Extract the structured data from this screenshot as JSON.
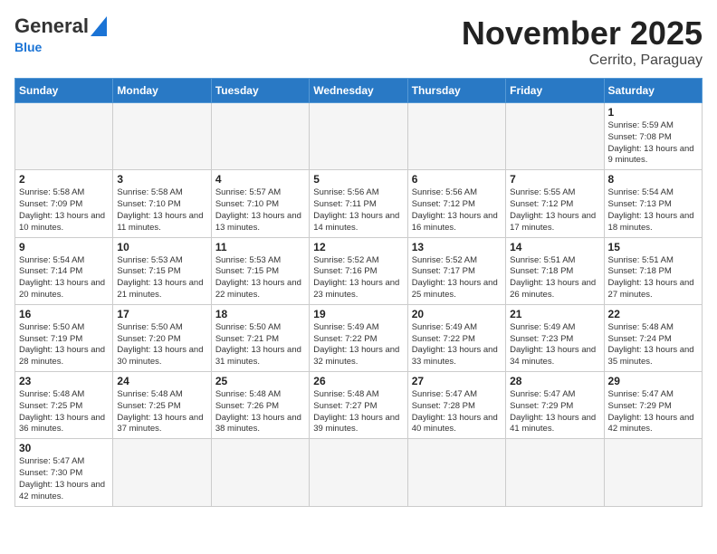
{
  "header": {
    "logo_general": "General",
    "logo_blue": "Blue",
    "month_title": "November 2025",
    "location": "Cerrito, Paraguay"
  },
  "weekdays": [
    "Sunday",
    "Monday",
    "Tuesday",
    "Wednesday",
    "Thursday",
    "Friday",
    "Saturday"
  ],
  "days": [
    {
      "num": "",
      "empty": true
    },
    {
      "num": "",
      "empty": true
    },
    {
      "num": "",
      "empty": true
    },
    {
      "num": "",
      "empty": true
    },
    {
      "num": "",
      "empty": true
    },
    {
      "num": "",
      "empty": true
    },
    {
      "num": "1",
      "sunrise": "5:59 AM",
      "sunset": "7:08 PM",
      "daylight": "13 hours and 9 minutes."
    },
    {
      "num": "2",
      "sunrise": "5:58 AM",
      "sunset": "7:09 PM",
      "daylight": "13 hours and 10 minutes."
    },
    {
      "num": "3",
      "sunrise": "5:58 AM",
      "sunset": "7:10 PM",
      "daylight": "13 hours and 11 minutes."
    },
    {
      "num": "4",
      "sunrise": "5:57 AM",
      "sunset": "7:10 PM",
      "daylight": "13 hours and 13 minutes."
    },
    {
      "num": "5",
      "sunrise": "5:56 AM",
      "sunset": "7:11 PM",
      "daylight": "13 hours and 14 minutes."
    },
    {
      "num": "6",
      "sunrise": "5:56 AM",
      "sunset": "7:12 PM",
      "daylight": "13 hours and 16 minutes."
    },
    {
      "num": "7",
      "sunrise": "5:55 AM",
      "sunset": "7:12 PM",
      "daylight": "13 hours and 17 minutes."
    },
    {
      "num": "8",
      "sunrise": "5:54 AM",
      "sunset": "7:13 PM",
      "daylight": "13 hours and 18 minutes."
    },
    {
      "num": "9",
      "sunrise": "5:54 AM",
      "sunset": "7:14 PM",
      "daylight": "13 hours and 20 minutes."
    },
    {
      "num": "10",
      "sunrise": "5:53 AM",
      "sunset": "7:15 PM",
      "daylight": "13 hours and 21 minutes."
    },
    {
      "num": "11",
      "sunrise": "5:53 AM",
      "sunset": "7:15 PM",
      "daylight": "13 hours and 22 minutes."
    },
    {
      "num": "12",
      "sunrise": "5:52 AM",
      "sunset": "7:16 PM",
      "daylight": "13 hours and 23 minutes."
    },
    {
      "num": "13",
      "sunrise": "5:52 AM",
      "sunset": "7:17 PM",
      "daylight": "13 hours and 25 minutes."
    },
    {
      "num": "14",
      "sunrise": "5:51 AM",
      "sunset": "7:18 PM",
      "daylight": "13 hours and 26 minutes."
    },
    {
      "num": "15",
      "sunrise": "5:51 AM",
      "sunset": "7:18 PM",
      "daylight": "13 hours and 27 minutes."
    },
    {
      "num": "16",
      "sunrise": "5:50 AM",
      "sunset": "7:19 PM",
      "daylight": "13 hours and 28 minutes."
    },
    {
      "num": "17",
      "sunrise": "5:50 AM",
      "sunset": "7:20 PM",
      "daylight": "13 hours and 30 minutes."
    },
    {
      "num": "18",
      "sunrise": "5:50 AM",
      "sunset": "7:21 PM",
      "daylight": "13 hours and 31 minutes."
    },
    {
      "num": "19",
      "sunrise": "5:49 AM",
      "sunset": "7:22 PM",
      "daylight": "13 hours and 32 minutes."
    },
    {
      "num": "20",
      "sunrise": "5:49 AM",
      "sunset": "7:22 PM",
      "daylight": "13 hours and 33 minutes."
    },
    {
      "num": "21",
      "sunrise": "5:49 AM",
      "sunset": "7:23 PM",
      "daylight": "13 hours and 34 minutes."
    },
    {
      "num": "22",
      "sunrise": "5:48 AM",
      "sunset": "7:24 PM",
      "daylight": "13 hours and 35 minutes."
    },
    {
      "num": "23",
      "sunrise": "5:48 AM",
      "sunset": "7:25 PM",
      "daylight": "13 hours and 36 minutes."
    },
    {
      "num": "24",
      "sunrise": "5:48 AM",
      "sunset": "7:25 PM",
      "daylight": "13 hours and 37 minutes."
    },
    {
      "num": "25",
      "sunrise": "5:48 AM",
      "sunset": "7:26 PM",
      "daylight": "13 hours and 38 minutes."
    },
    {
      "num": "26",
      "sunrise": "5:48 AM",
      "sunset": "7:27 PM",
      "daylight": "13 hours and 39 minutes."
    },
    {
      "num": "27",
      "sunrise": "5:47 AM",
      "sunset": "7:28 PM",
      "daylight": "13 hours and 40 minutes."
    },
    {
      "num": "28",
      "sunrise": "5:47 AM",
      "sunset": "7:29 PM",
      "daylight": "13 hours and 41 minutes."
    },
    {
      "num": "29",
      "sunrise": "5:47 AM",
      "sunset": "7:29 PM",
      "daylight": "13 hours and 42 minutes."
    },
    {
      "num": "30",
      "sunrise": "5:47 AM",
      "sunset": "7:30 PM",
      "daylight": "13 hours and 42 minutes."
    },
    {
      "num": "",
      "empty": true
    },
    {
      "num": "",
      "empty": true
    },
    {
      "num": "",
      "empty": true
    },
    {
      "num": "",
      "empty": true
    },
    {
      "num": "",
      "empty": true
    },
    {
      "num": "",
      "empty": true
    }
  ],
  "labels": {
    "sunrise": "Sunrise:",
    "sunset": "Sunset:",
    "daylight": "Daylight:"
  }
}
